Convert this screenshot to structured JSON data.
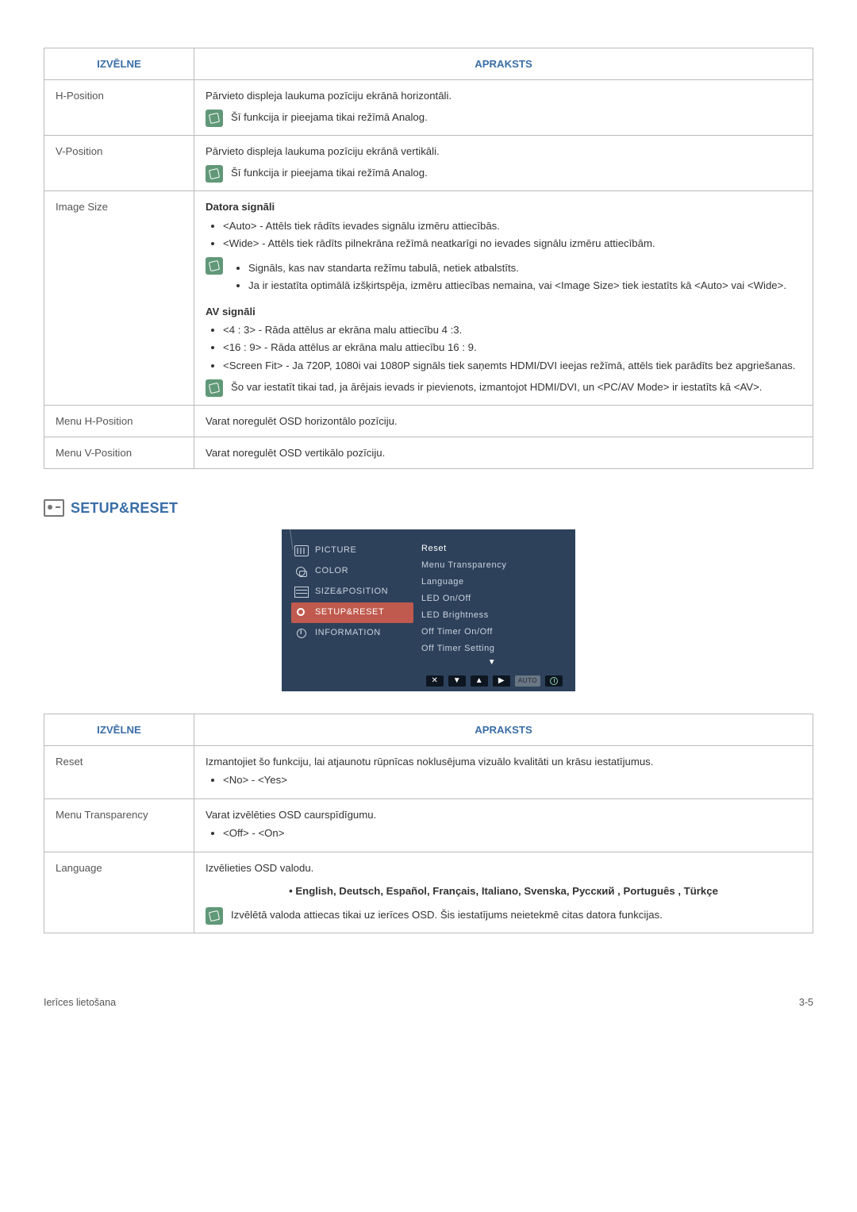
{
  "table1": {
    "headers": {
      "menu": "IZVĒLNE",
      "desc": "APRAKSTS"
    },
    "rows": {
      "hpos": {
        "label": "H-Position",
        "desc": "Pārvieto displeja laukuma pozīciju ekrānā horizontāli.",
        "note": "Šī funkcija ir pieejama tikai režīmā Analog."
      },
      "vpos": {
        "label": "V-Position",
        "desc": "Pārvieto displeja laukuma pozīciju ekrānā vertikāli.",
        "note": "Šī funkcija ir pieejama tikai režīmā Analog."
      },
      "imgsize": {
        "label": "Image Size",
        "pc_header": "Datora signāli",
        "pc_auto": "<Auto> - Attēls tiek rādīts ievades signālu izmēru attiecībās.",
        "pc_wide": "<Wide> - Attēls tiek rādīts pilnekrāna režīmā neatkarīgi no ievades signālu izmēru attiecībām.",
        "pc_note1": "Signāls, kas nav standarta režīmu tabulā, netiek atbalstīts.",
        "pc_note2": "Ja ir iestatīta optimālā izšķirtspēja, izmēru attiecības nemaina, vai <Image Size> tiek iestatīts kā <Auto> vai <Wide>.",
        "av_header": "AV signāli",
        "av_43": "<4 : 3> - Rāda attēlus ar ekrāna malu attiecību 4 :3.",
        "av_169": "<16 : 9> - Rāda attēlus ar ekrāna malu attiecību 16 : 9.",
        "av_fit": "<Screen Fit> - Ja 720P, 1080i vai 1080P signāls tiek saņemts HDMI/DVI ieejas režīmā, attēls tiek parādīts bez apgriešanas.",
        "av_note": "Šo var iestatīt tikai tad, ja ārējais ievads ir pievienots, izmantojot HDMI/DVI, un <PC/AV Mode> ir iestatīts kā <AV>."
      },
      "mhpos": {
        "label": "Menu H-Position",
        "desc": "Varat noregulēt OSD horizontālo pozīciju."
      },
      "mvpos": {
        "label": "Menu V-Position",
        "desc": "Varat noregulēt OSD vertikālo pozīciju."
      }
    }
  },
  "section_title": "SETUP&RESET",
  "osd": {
    "left": {
      "picture": "PICTURE",
      "color": "COLOR",
      "size": "SIZE&POSITION",
      "setup": "SETUP&RESET",
      "info": "INFORMATION"
    },
    "right": {
      "reset": "Reset",
      "transparency": "Menu Transparency",
      "language": "Language",
      "led_onoff": "LED On/Off",
      "led_bright": "LED Brightness",
      "off_onoff": "Off Timer On/Off",
      "off_setting": "Off Timer Setting"
    },
    "foot_auto": "AUTO"
  },
  "table2": {
    "headers": {
      "menu": "IZVĒLNE",
      "desc": "APRAKSTS"
    },
    "rows": {
      "reset": {
        "label": "Reset",
        "desc": "Izmantojiet šo funkciju, lai atjaunotu rūpnīcas noklusējuma vizuālo kvalitāti un krāsu iestatījumus.",
        "opts": "<No> - <Yes>"
      },
      "transparency": {
        "label": "Menu Transparency",
        "desc": "Varat izvēlēties OSD caurspīdīgumu.",
        "opts": "<Off> - <On>"
      },
      "language": {
        "label": "Language",
        "desc": "Izvēlieties OSD valodu.",
        "list": "• English, Deutsch, Español, Français,  Italiano, Svenska, Русский , Português , Türkçe",
        "note": "Izvēlētā valoda attiecas tikai uz ierīces OSD. Šis iestatījums neietekmē citas datora funkcijas."
      }
    }
  },
  "footer": {
    "left": "Ierīces lietošana",
    "right": "3-5"
  }
}
